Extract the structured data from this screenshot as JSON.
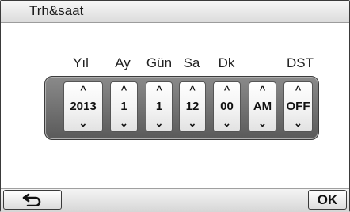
{
  "title": "Trh&saat",
  "columns": [
    {
      "label": "Yıl",
      "value": "2013"
    },
    {
      "label": "Ay",
      "value": "1"
    },
    {
      "label": "Gün",
      "value": "1"
    },
    {
      "label": "Sa",
      "value": "12"
    },
    {
      "label": "Dk",
      "value": "00"
    },
    {
      "label": "",
      "value": "AM"
    },
    {
      "label": "DST",
      "value": "OFF"
    }
  ],
  "arrows": {
    "up": "^",
    "down": "⌄"
  },
  "buttons": {
    "ok": "OK",
    "back_icon": "back-arrow-icon"
  }
}
